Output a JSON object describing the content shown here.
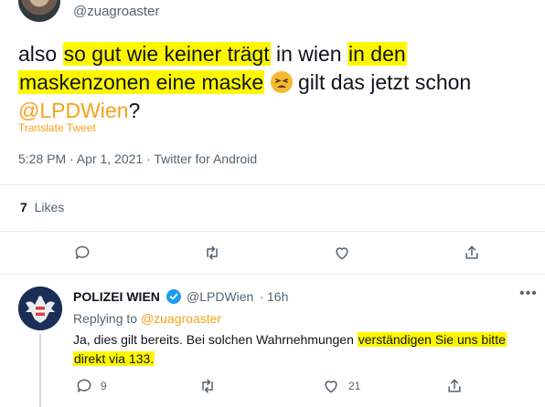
{
  "tweet": {
    "author_handle": "@zuagroaster",
    "text_1": "also ",
    "text_hl_1": "so gut wie keiner trägt",
    "text_2": " in wien ",
    "text_hl_2a": "in den",
    "text_hl_2b": "maskenzonen eine maske",
    "text_3": " gilt das jetzt schon",
    "mention": "@LPDWien",
    "text_4": "?",
    "emoji": "tired-face-emoji",
    "translate": "Translate Tweet",
    "meta": "5:28 PM · Apr 1, 2021 · Twitter for Android",
    "likes_count": "7",
    "likes_label": "Likes"
  },
  "reply": {
    "name": "POLIZEI WIEN",
    "handle": "@LPDWien",
    "dot": "·",
    "time": "16h",
    "more": "•••",
    "replying_prefix": "Replying to",
    "replying_to": "@zuagroaster",
    "text_1": "Ja, dies gilt bereits. Bei solchen Wahrnehmungen ",
    "text_hl_1": "verständigen Sie uns bitte",
    "text_hl_2": "direkt via 133.",
    "reply_count": "9",
    "like_count": "21"
  },
  "colors": {
    "accent": "#f7a21b",
    "highlight": "#fff700",
    "muted": "#536471",
    "verified": "#1d9bf0"
  }
}
